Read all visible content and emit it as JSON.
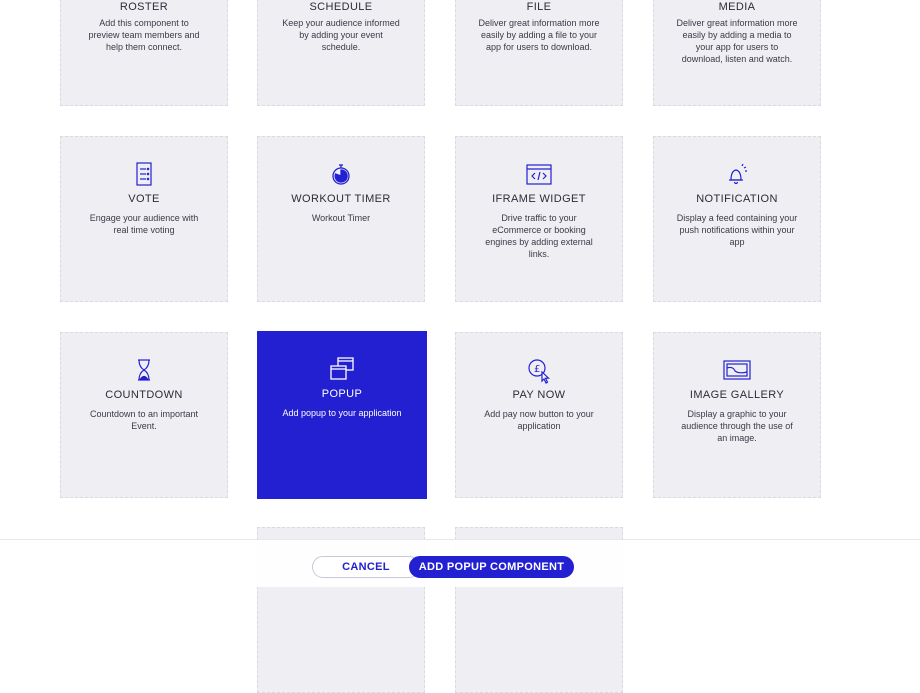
{
  "cards": [
    {
      "id": "roster",
      "title": "ROSTER",
      "desc": "Add this component to preview team members and help them connect.",
      "icon": "roster-icon"
    },
    {
      "id": "schedule",
      "title": "SCHEDULE",
      "desc": "Keep your audience informed by adding your event schedule.",
      "icon": "schedule-icon"
    },
    {
      "id": "file",
      "title": "FILE",
      "desc": "Deliver great information more easily by adding a file to your app for users to download.",
      "icon": "file-icon"
    },
    {
      "id": "media",
      "title": "MEDIA",
      "desc": "Deliver great information more easily by adding a media to your app for users to download, listen and watch.",
      "icon": "media-icon"
    },
    {
      "id": "vote",
      "title": "VOTE",
      "desc": "Engage your audience with real time voting",
      "icon": "vote-icon"
    },
    {
      "id": "workout-timer",
      "title": "WORKOUT TIMER",
      "desc": "Workout Timer",
      "icon": "stopwatch-icon"
    },
    {
      "id": "iframe-widget",
      "title": "IFRAME WIDGET",
      "desc": "Drive traffic to your eCommerce or booking engines by adding external links.",
      "icon": "code-window-icon"
    },
    {
      "id": "notification",
      "title": "NOTIFICATION",
      "desc": "Display a feed containing your push notifications within your app",
      "icon": "bell-icon"
    },
    {
      "id": "countdown",
      "title": "COUNTDOWN",
      "desc": "Countdown to an important Event.",
      "icon": "hourglass-icon"
    },
    {
      "id": "popup",
      "title": "POPUP",
      "desc": "Add popup to your application",
      "icon": "popup-icon",
      "selected": true
    },
    {
      "id": "pay-now",
      "title": "PAY NOW",
      "desc": "Add pay now button to your application",
      "icon": "pay-icon"
    },
    {
      "id": "image-gallery",
      "title": "IMAGE GALLERY",
      "desc": "Display a graphic to your audience through the use of an image.",
      "icon": "image-icon"
    }
  ],
  "footer": {
    "cancel_label": "CANCEL",
    "add_label": "ADD POPUP COMPONENT"
  },
  "colors": {
    "accent": "#2320d2",
    "card_bg": "#efeff3"
  }
}
